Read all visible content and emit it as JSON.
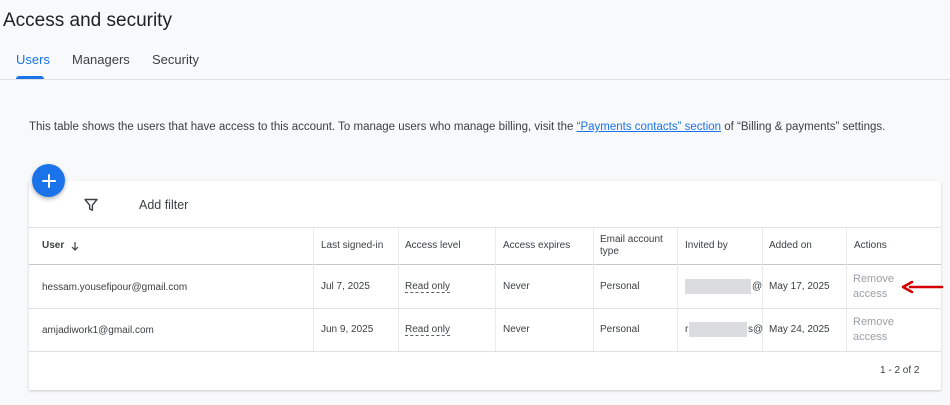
{
  "page": {
    "title": "Access and security"
  },
  "tabs": [
    {
      "label": "Users",
      "active": true
    },
    {
      "label": "Managers",
      "active": false
    },
    {
      "label": "Security",
      "active": false
    }
  ],
  "description": {
    "prefix": "This table shows the users that have access to this account. To manage users who manage billing, visit the ",
    "link": "“Payments contacts” section",
    "suffix": " of “Billing & payments” settings."
  },
  "toolbar": {
    "add_icon": "plus-icon",
    "filter_icon": "filter-funnel-icon",
    "filter_label": "Add filter"
  },
  "table": {
    "columns": {
      "user": "User",
      "last_signed_in": "Last signed-in",
      "access_level": "Access level",
      "access_expires": "Access expires",
      "email_account_type": "Email account type",
      "invited_by": "Invited by",
      "added_on": "Added on",
      "actions": "Actions"
    },
    "sort_icon": "arrow-down-icon",
    "rows": [
      {
        "user": "hessam.yousefipour@gmail.com",
        "last_signed_in": "Jul 7, 2025",
        "access_level": "Read only",
        "access_expires": "Never",
        "email_account_type": "Personal",
        "invited_by_suffix": "@",
        "added_on": "May 17, 2025",
        "action": "Remove access"
      },
      {
        "user": "amjadiwork1@gmail.com",
        "last_signed_in": "Jun 9, 2025",
        "access_level": "Read only",
        "access_expires": "Never",
        "email_account_type": "Personal",
        "invited_by_prefix": "r",
        "invited_by_suffix": "s@",
        "added_on": "May 24, 2025",
        "action": "Remove access"
      }
    ],
    "pagination": "1 - 2 of 2"
  },
  "annotation": {
    "icon": "red-arrow-icon",
    "color": "#d50000"
  },
  "colors": {
    "accent": "#1a73e8",
    "disabled_text": "#9aa0a6"
  }
}
